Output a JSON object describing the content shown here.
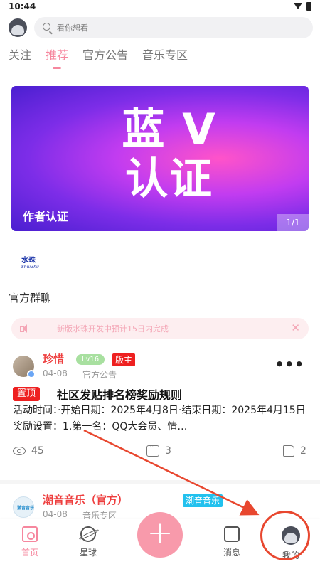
{
  "status_bar": {
    "time": "10:44"
  },
  "header": {
    "search_placeholder": "看你想看"
  },
  "tabs": [
    {
      "label": "关注"
    },
    {
      "label": "推荐",
      "active": true
    },
    {
      "label": "官方公告"
    },
    {
      "label": "音乐专区"
    }
  ],
  "banner": {
    "title_line1": "蓝 V",
    "title_line2": "认证",
    "caption": "作者认证",
    "counter": "1/1"
  },
  "brand": {
    "name": "水珠",
    "sub": "ShuiZhu"
  },
  "group_chat": "官方群聊",
  "notice": {
    "text": "新版水珠开发中预计15日内完成"
  },
  "posts": [
    {
      "author": "珍惜",
      "level": "Lv16",
      "role": "版主",
      "date": "04-08",
      "board": "官方公告",
      "pin": "置顶",
      "title": "社区发贴排名榜奖励规则",
      "body": "活动时间：·开始日期：2025年4月8日·结束日期：2025年4月15日奖励设置：1.第一名：QQ大会员、情…",
      "views": "45",
      "comments": "3",
      "likes": "2"
    },
    {
      "author": "潮音音乐（官方）",
      "tag": "潮音音乐",
      "date": "04-08",
      "board": "音乐专区",
      "logo_text": "潮音音乐"
    }
  ],
  "bottom_nav": {
    "home": "首页",
    "planet": "星球",
    "add": "+",
    "messages": "消息",
    "me": "我的"
  },
  "colors": {
    "accent": "#f6879e",
    "annotation": "#e8472f"
  }
}
